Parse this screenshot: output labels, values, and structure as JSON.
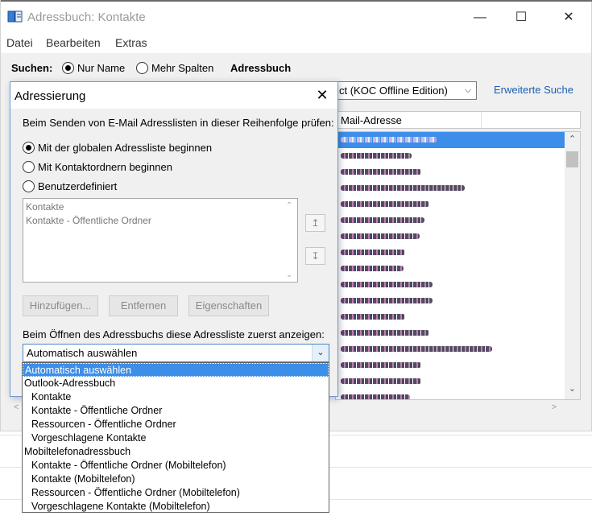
{
  "window": {
    "title": "Adressbuch: Kontakte",
    "controls": {
      "minimize": "—",
      "maximize": "☐",
      "close": "✕"
    }
  },
  "menu": [
    "Datei",
    "Bearbeiten",
    "Extras"
  ],
  "search": {
    "label": "Suchen:",
    "options": [
      {
        "label": "Nur Name",
        "selected": true
      },
      {
        "label": "Mehr Spalten",
        "selected": false
      }
    ],
    "addressbook_label": "Adressbuch",
    "addressbook_value": "ct (KOC Offline Edition)",
    "advanced_link": "Erweiterte Suche"
  },
  "contact_list": {
    "column": "Mail-Adresse",
    "rows": [
      {
        "selected": true
      },
      {},
      {},
      {},
      {},
      {},
      {},
      {},
      {},
      {},
      {},
      {},
      {},
      {},
      {},
      {},
      {}
    ]
  },
  "dialog": {
    "title": "Adressierung",
    "close": "✕",
    "intro": "Beim Senden von E-Mail Adresslisten in dieser Reihenfolge prüfen:",
    "options": [
      {
        "label": "Mit der globalen Adressliste beginnen",
        "selected": true
      },
      {
        "label": "Mit Kontaktordnern beginnen",
        "selected": false
      },
      {
        "label": "Benutzerdefiniert",
        "selected": false
      }
    ],
    "order_list": [
      "Kontakte",
      "Kontakte - Öffentliche Ordner"
    ],
    "buttons": {
      "add": "Hinzufügen...",
      "remove": "Entfernen",
      "properties": "Eigenschaften"
    },
    "open_label": "Beim Öffnen des Adressbuchs diese Adressliste zuerst anzeigen:",
    "open_value": "Automatisch auswählen"
  },
  "dropdown": [
    {
      "label": "Automatisch auswählen",
      "level": 0,
      "selected": true
    },
    {
      "label": "Outlook-Adressbuch",
      "level": 0
    },
    {
      "label": "Kontakte",
      "level": 1
    },
    {
      "label": "Kontakte - Öffentliche Ordner",
      "level": 1
    },
    {
      "label": "Ressourcen - Öffentliche Ordner",
      "level": 1
    },
    {
      "label": "Vorgeschlagene Kontakte",
      "level": 1
    },
    {
      "label": "Mobiltelefonadressbuch",
      "level": 0
    },
    {
      "label": "Kontakte - Öffentliche Ordner (Mobiltelefon)",
      "level": 1
    },
    {
      "label": "Kontakte (Mobiltelefon)",
      "level": 1
    },
    {
      "label": "Ressourcen - Öffentliche Ordner (Mobiltelefon)",
      "level": 1
    },
    {
      "label": "Vorgeschlagene Kontakte (Mobiltelefon)",
      "level": 1
    }
  ],
  "colors": {
    "accent": "#3d8ee8",
    "link": "#1a5fb4"
  }
}
